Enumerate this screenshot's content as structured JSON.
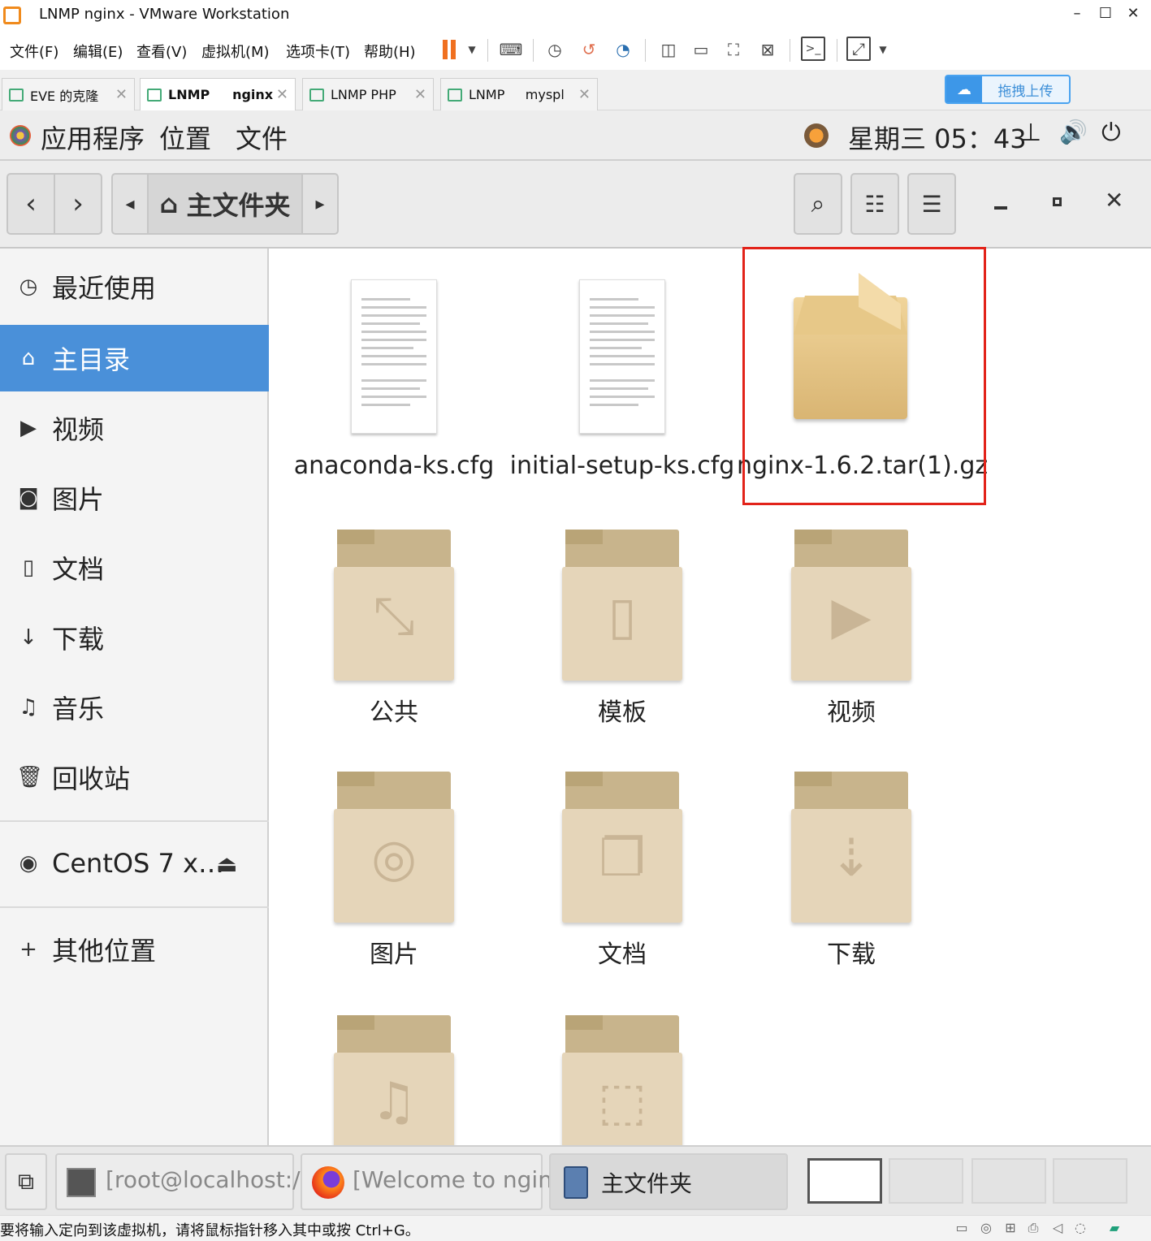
{
  "window": {
    "title": "LNMP    nginx - VMware Workstation",
    "minimize": "–",
    "maximize": "☐",
    "close": "✕"
  },
  "menus": [
    "文件(F)",
    "编辑(E)",
    "查看(V)",
    "虚拟机(M)",
    "选项卡(T)",
    "帮助(H)"
  ],
  "tabs": [
    {
      "label": "EVE 的克隆",
      "active": false
    },
    {
      "label": "LNMP     nginx",
      "active": true
    },
    {
      "label": "LNMP PHP",
      "active": false
    },
    {
      "label": "LNMP     myspl",
      "active": false
    }
  ],
  "upload": {
    "label": "拖拽上传"
  },
  "gnome": {
    "apps": "应用程序",
    "places": "位置",
    "files": "文件",
    "clock": "星期三 05：43"
  },
  "header": {
    "path": "主文件夹",
    "back": "‹",
    "forward": "›"
  },
  "sidebar": {
    "recent": "最近使用",
    "home": "主目录",
    "videos": "视频",
    "pictures": "图片",
    "documents": "文档",
    "downloads": "下载",
    "music": "音乐",
    "trash": "回收站",
    "device": "CentOS 7 x…",
    "other": "其他位置"
  },
  "files": {
    "f1": "anaconda-ks.cfg",
    "f2": "initial-setup-ks.cfg",
    "f3": "nginx-1.6.2.tar(1).gz",
    "d1": "公共",
    "d2": "模板",
    "d3": "视频",
    "d4": "图片",
    "d5": "文档",
    "d6": "下载"
  },
  "taskbar": {
    "t1": "[root@localhost:/u…",
    "t2": "[Welcome to nginx!…",
    "t3": "主文件夹"
  },
  "status": {
    "text": "要将输入定向到该虚拟机，请将鼠标指针移入其中或按 Ctrl+G。"
  },
  "colors": {
    "selected": "#4a90d9",
    "highlight_box": "#e2231a",
    "folder": "#e5d5b9"
  }
}
